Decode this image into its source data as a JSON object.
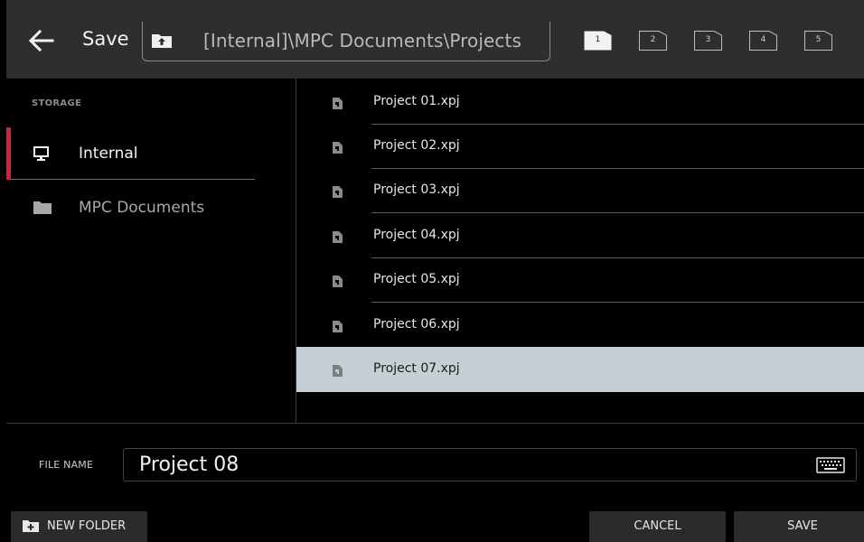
{
  "header": {
    "title": "Save",
    "path": "[Internal]\\MPC Documents\\Projects",
    "slots": [
      "1",
      "2",
      "3",
      "4",
      "5"
    ],
    "active_slot": "1"
  },
  "sidebar": {
    "section_label": "STORAGE",
    "items": [
      {
        "label": "Internal",
        "icon": "monitor-icon",
        "selected": true
      },
      {
        "label": "MPC Documents",
        "icon": "folder-icon",
        "selected": false
      }
    ]
  },
  "files": [
    {
      "name": "Project 01.xpj"
    },
    {
      "name": "Project 02.xpj"
    },
    {
      "name": "Project 03.xpj"
    },
    {
      "name": "Project 04.xpj"
    },
    {
      "name": "Project 05.xpj"
    },
    {
      "name": "Project 06.xpj"
    },
    {
      "name": "Project 07.xpj"
    }
  ],
  "selected_file": "Project 07.xpj",
  "filename": {
    "label": "FILE NAME",
    "value": "Project 08"
  },
  "buttons": {
    "new_folder": "NEW FOLDER",
    "cancel": "CANCEL",
    "save": "SAVE"
  },
  "colors": {
    "accent": "#d8203c",
    "header_bg": "#2e2e2e",
    "selected_row": "#c6cfd4"
  }
}
